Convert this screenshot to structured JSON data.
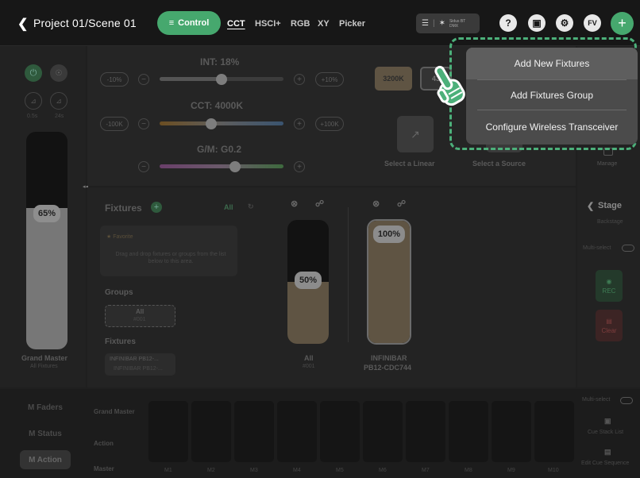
{
  "header": {
    "title": "Project 01/Scene 01",
    "control_label": "Control",
    "modes": [
      "CCT",
      "HSCI+",
      "RGB",
      "XY",
      "Picker"
    ],
    "bt_line1": "Sidus BT",
    "bt_line2": "DMX",
    "help_icon": "?",
    "user_badge": "FV",
    "add_label": "+"
  },
  "left": {
    "time1": "0.5s",
    "time2": "24s",
    "grand_master_pct": "65%",
    "grand_master_label": "Grand Master",
    "grand_master_sub": "All Fixtures",
    "collapse_glyph": "◂◂"
  },
  "sliders": {
    "int_label": "INT: 18%",
    "int_minus": "-10%",
    "int_plus": "+10%",
    "cct_label": "CCT: 4000K",
    "cct_minus": "-100K",
    "cct_plus": "+100K",
    "gm_label": "G/M: G0.2",
    "preset1": "3200K",
    "preset2": "43",
    "linear_label": "Select a Linear",
    "source_label": "Select a Source"
  },
  "fixtures_panel": {
    "title": "Fixtures",
    "filter": "All",
    "favorite": "★ Favorite",
    "drop_hint": "Drag and drop fixtures or groups from the list below to this area.",
    "groups_title": "Groups",
    "group_all": "All",
    "group_all_sub": "#001",
    "fixtures_title": "Fixtures",
    "fixture_item": "INFINIBAR PB12-...",
    "fixture_item_sub": "INFINIBAR PB12-..."
  },
  "faders": {
    "all_pct": "50%",
    "all_label": "All",
    "all_sub": "#001",
    "fixture_pct": "100%",
    "fixture_label_1": "INFINIBAR",
    "fixture_label_2": "PB12-CDC744"
  },
  "right": {
    "manage": "Manage",
    "stage": "Stage",
    "backstage": "Backstage",
    "multiselect": "Multi-select",
    "rec": "REC",
    "clear": "Clear"
  },
  "bottom": {
    "m_faders": "M Faders",
    "m_status": "M Status",
    "m_action": "M Action",
    "grand_master": "Grand Master",
    "action": "Action",
    "master": "Master",
    "cells": [
      "M1",
      "M2",
      "M3",
      "M4",
      "M5",
      "M6",
      "M7",
      "M8",
      "M9",
      "M10"
    ],
    "multiselect": "Multi-select",
    "cue_stack": "Cue Stack List",
    "edit_cue": "Edit Cue Sequence"
  },
  "dropdown": {
    "items": [
      "Add New Fixtures",
      "Add Fixtures Group",
      "Configure Wireless Transceiver"
    ]
  },
  "colors": {
    "accent": "#46a86e",
    "highlight_outline": "#4cb07a",
    "fader_fill": "#b39b7c"
  }
}
